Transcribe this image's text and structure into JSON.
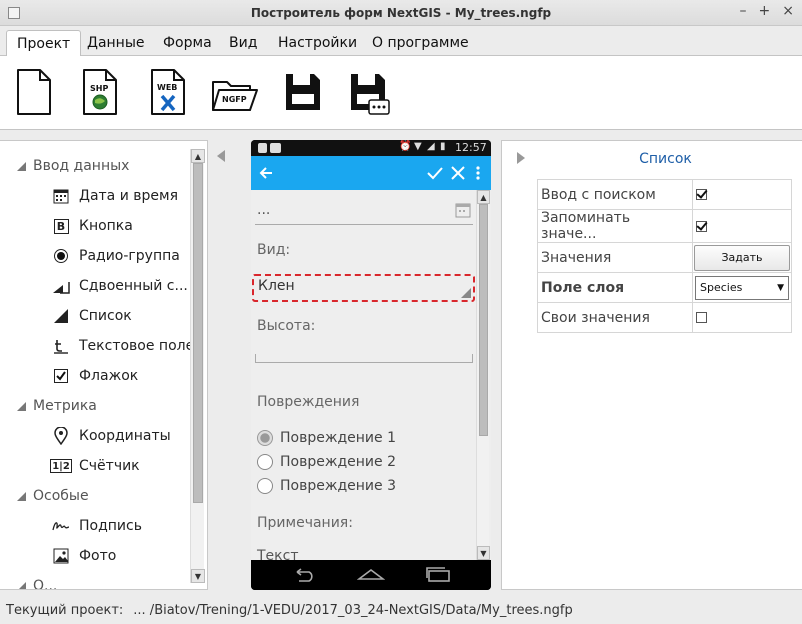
{
  "window": {
    "title": "Построитель форм NextGIS - My_trees.ngfp",
    "controls": [
      "–",
      "+",
      "×"
    ]
  },
  "menu": {
    "tabs": [
      {
        "label": "Проект",
        "active": true
      },
      {
        "label": "Данные",
        "active": false
      },
      {
        "label": "Форма",
        "active": false
      },
      {
        "label": "Вид",
        "active": false
      },
      {
        "label": "Настройки",
        "active": false
      },
      {
        "label": "О программе",
        "active": false
      }
    ]
  },
  "toolbar": {
    "buttons": [
      {
        "icon": "new-file-icon",
        "badge": ""
      },
      {
        "icon": "shp-file-icon",
        "badge": "SHP"
      },
      {
        "icon": "web-file-icon",
        "badge": "WEB"
      },
      {
        "icon": "ngfp-folder-icon",
        "badge": "NGFP"
      },
      {
        "icon": "save-icon",
        "badge": ""
      },
      {
        "icon": "save-as-icon",
        "badge": ""
      }
    ]
  },
  "tree": {
    "groups": [
      {
        "label": "Ввод данных",
        "items": [
          "Дата и время",
          "Кнопка",
          "Радио-группа",
          "Сдвоенный с...",
          "Список",
          "Текстовое поле",
          "Флажок"
        ]
      },
      {
        "label": "Метрика",
        "items": [
          "Координаты",
          "Счётчик"
        ]
      },
      {
        "label": "Особые",
        "items": [
          "Подпись",
          "Фото"
        ]
      },
      {
        "label": "О...",
        "items": []
      }
    ],
    "badges": {
      "button": "B",
      "counter": "1|2"
    }
  },
  "phone": {
    "time": "12:57",
    "date_placeholder": "...",
    "field_vid_label": "Вид:",
    "field_vid_value": "Клен",
    "field_height_label": "Высота:",
    "damage_label": "Повреждения",
    "radios": [
      "Повреждение 1",
      "Повреждение 2",
      "Повреждение 3"
    ],
    "selected_radio": 0,
    "notes_label": "Примечания:",
    "text_placeholder": "Текст"
  },
  "properties": {
    "title": "Список",
    "rows": [
      {
        "key": "Ввод с поиском",
        "type": "checkbox",
        "checked": true
      },
      {
        "key": "Запоминать значе...",
        "type": "checkbox",
        "checked": true
      },
      {
        "key": "Значения",
        "type": "button",
        "button_label": "Задать"
      },
      {
        "key": "Поле слоя",
        "type": "combo",
        "value": "Species",
        "bold": true
      },
      {
        "key": "Свои значения",
        "type": "checkbox",
        "checked": false
      }
    ]
  },
  "status": {
    "label": "Текущий проект:",
    "path": "... /Biatov/Trening/1-VEDU/2017_03_24-NextGIS/Data/My_trees.ngfp"
  },
  "colors": {
    "accent_blue": "#1aa7f0",
    "title_link": "#1f5fa8",
    "selection_dashed": "#d9262c"
  }
}
